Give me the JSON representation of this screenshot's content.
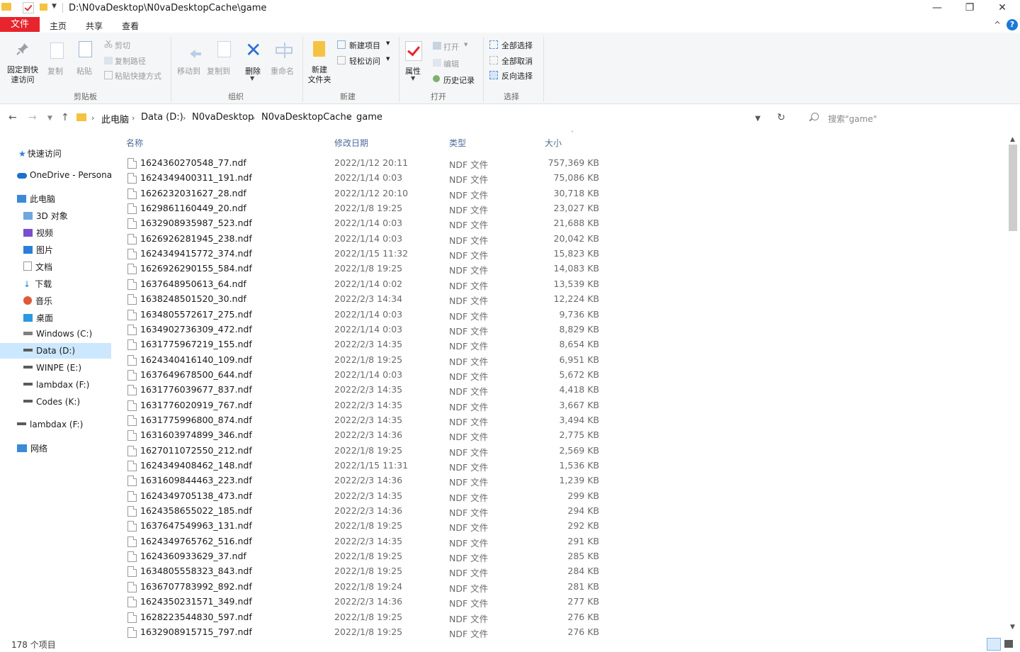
{
  "window": {
    "title": "D:\\N0vaDesktop\\N0vaDesktopCache\\game",
    "minimize": "—",
    "restore": "❐",
    "close": "✕"
  },
  "menu": {
    "file": "文件",
    "tabs": [
      "主页",
      "共享",
      "查看"
    ],
    "collapse_ribbon": "^",
    "help": "?"
  },
  "ribbon": {
    "clipboard": {
      "pin": "固定到快",
      "pin2": "速访问",
      "copy": "复制",
      "paste": "粘贴",
      "cut": "剪切",
      "copy_path": "复制路径",
      "paste_shortcut": "粘贴快捷方式",
      "group": "剪贴板"
    },
    "organize": {
      "move_to": "移动到",
      "copy_to": "复制到",
      "delete": "删除",
      "rename": "重命名",
      "group": "组织"
    },
    "new": {
      "new_folder": "新建",
      "new_folder2": "文件夹",
      "new_item": "新建项目",
      "easy_access": "轻松访问",
      "group": "新建"
    },
    "open": {
      "properties": "属性",
      "open": "打开",
      "edit": "编辑",
      "history": "历史记录",
      "group": "打开"
    },
    "select": {
      "select_all": "全部选择",
      "select_none": "全部取消",
      "invert": "反向选择",
      "group": "选择"
    }
  },
  "address": {
    "crumbs": [
      "此电脑",
      "Data (D:)",
      "N0vaDesktop",
      "N0vaDesktopCache",
      "game"
    ],
    "search_placeholder": "搜索\"game\""
  },
  "sidebar": {
    "quick_access": "快速访问",
    "onedrive": "OneDrive - Persona",
    "this_pc": "此电脑",
    "items": [
      "3D 对象",
      "视频",
      "图片",
      "文档",
      "下载",
      "音乐",
      "桌面",
      "Windows (C:)",
      "Data (D:)",
      "WINPE (E:)",
      "lambdax (F:)",
      "Codes (K:)"
    ],
    "lambdax": "lambdax (F:)",
    "network": "网络"
  },
  "columns": {
    "name": "名称",
    "date": "修改日期",
    "type": "类型",
    "size": "大小"
  },
  "files": [
    {
      "name": "1624360270548_77.ndf",
      "date": "2022/1/12 20:11",
      "type": "NDF 文件",
      "size": "757,369 KB"
    },
    {
      "name": "1624349400311_191.ndf",
      "date": "2022/1/14 0:03",
      "type": "NDF 文件",
      "size": "75,086 KB"
    },
    {
      "name": "1626232031627_28.ndf",
      "date": "2022/1/12 20:10",
      "type": "NDF 文件",
      "size": "30,718 KB"
    },
    {
      "name": "1629861160449_20.ndf",
      "date": "2022/1/8 19:25",
      "type": "NDF 文件",
      "size": "23,027 KB"
    },
    {
      "name": "1632908935987_523.ndf",
      "date": "2022/1/14 0:03",
      "type": "NDF 文件",
      "size": "21,688 KB"
    },
    {
      "name": "1626926281945_238.ndf",
      "date": "2022/1/14 0:03",
      "type": "NDF 文件",
      "size": "20,042 KB"
    },
    {
      "name": "1624349415772_374.ndf",
      "date": "2022/1/15 11:32",
      "type": "NDF 文件",
      "size": "15,823 KB"
    },
    {
      "name": "1626926290155_584.ndf",
      "date": "2022/1/8 19:25",
      "type": "NDF 文件",
      "size": "14,083 KB"
    },
    {
      "name": "1637648950613_64.ndf",
      "date": "2022/1/14 0:02",
      "type": "NDF 文件",
      "size": "13,539 KB"
    },
    {
      "name": "1638248501520_30.ndf",
      "date": "2022/2/3 14:34",
      "type": "NDF 文件",
      "size": "12,224 KB"
    },
    {
      "name": "1634805572617_275.ndf",
      "date": "2022/1/14 0:03",
      "type": "NDF 文件",
      "size": "9,736 KB"
    },
    {
      "name": "1634902736309_472.ndf",
      "date": "2022/1/14 0:03",
      "type": "NDF 文件",
      "size": "8,829 KB"
    },
    {
      "name": "1631775967219_155.ndf",
      "date": "2022/2/3 14:35",
      "type": "NDF 文件",
      "size": "8,654 KB"
    },
    {
      "name": "1624340416140_109.ndf",
      "date": "2022/1/8 19:25",
      "type": "NDF 文件",
      "size": "6,951 KB"
    },
    {
      "name": "1637649678500_644.ndf",
      "date": "2022/1/14 0:03",
      "type": "NDF 文件",
      "size": "5,672 KB"
    },
    {
      "name": "1631776039677_837.ndf",
      "date": "2022/2/3 14:35",
      "type": "NDF 文件",
      "size": "4,418 KB"
    },
    {
      "name": "1631776020919_767.ndf",
      "date": "2022/2/3 14:35",
      "type": "NDF 文件",
      "size": "3,667 KB"
    },
    {
      "name": "1631775996800_874.ndf",
      "date": "2022/2/3 14:35",
      "type": "NDF 文件",
      "size": "3,494 KB"
    },
    {
      "name": "1631603974899_346.ndf",
      "date": "2022/2/3 14:36",
      "type": "NDF 文件",
      "size": "2,775 KB"
    },
    {
      "name": "1627011072550_212.ndf",
      "date": "2022/1/8 19:25",
      "type": "NDF 文件",
      "size": "2,569 KB"
    },
    {
      "name": "1624349408462_148.ndf",
      "date": "2022/1/15 11:31",
      "type": "NDF 文件",
      "size": "1,536 KB"
    },
    {
      "name": "1631609844463_223.ndf",
      "date": "2022/2/3 14:36",
      "type": "NDF 文件",
      "size": "1,239 KB"
    },
    {
      "name": "1624349705138_473.ndf",
      "date": "2022/2/3 14:35",
      "type": "NDF 文件",
      "size": "299 KB"
    },
    {
      "name": "1624358655022_185.ndf",
      "date": "2022/2/3 14:36",
      "type": "NDF 文件",
      "size": "294 KB"
    },
    {
      "name": "1637647549963_131.ndf",
      "date": "2022/1/8 19:25",
      "type": "NDF 文件",
      "size": "292 KB"
    },
    {
      "name": "1624349765762_516.ndf",
      "date": "2022/2/3 14:35",
      "type": "NDF 文件",
      "size": "291 KB"
    },
    {
      "name": "1624360933629_37.ndf",
      "date": "2022/1/8 19:25",
      "type": "NDF 文件",
      "size": "285 KB"
    },
    {
      "name": "1634805558323_843.ndf",
      "date": "2022/1/8 19:25",
      "type": "NDF 文件",
      "size": "284 KB"
    },
    {
      "name": "1636707783992_892.ndf",
      "date": "2022/1/8 19:24",
      "type": "NDF 文件",
      "size": "281 KB"
    },
    {
      "name": "1624350231571_349.ndf",
      "date": "2022/2/3 14:36",
      "type": "NDF 文件",
      "size": "277 KB"
    },
    {
      "name": "1628223544830_597.ndf",
      "date": "2022/1/8 19:25",
      "type": "NDF 文件",
      "size": "276 KB"
    },
    {
      "name": "1632908915715_797.ndf",
      "date": "2022/1/8 19:25",
      "type": "NDF 文件",
      "size": "276 KB"
    }
  ],
  "status": {
    "count": "178 个项目"
  },
  "colors": {
    "file_tab": "#e8242c",
    "selection": "#cce8ff",
    "header_text": "#4a6d9a",
    "help": "#1a78d6"
  }
}
